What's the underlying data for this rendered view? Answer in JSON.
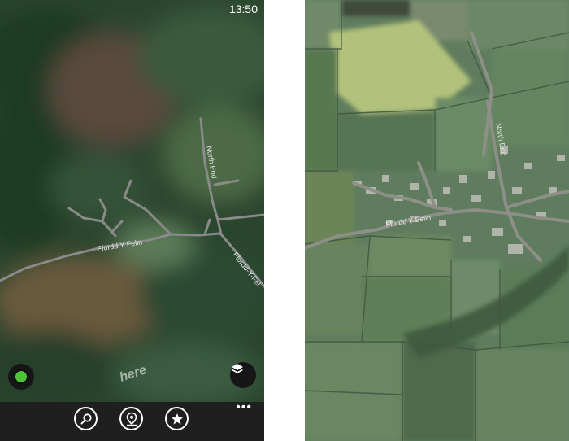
{
  "status_bar": {
    "time": "13:50"
  },
  "phone_map": {
    "roads": [
      "North End",
      "Ffordd Y Felin",
      "Ffordd-Y-Fel"
    ],
    "watermark": "here",
    "location_button_icon": "location-dot-icon",
    "layers_button_icon": "layers-icon"
  },
  "app_bar": {
    "buttons": [
      {
        "icon": "search-icon"
      },
      {
        "icon": "places-icon"
      },
      {
        "icon": "favorites-icon"
      }
    ],
    "more_icon": "ellipsis-icon",
    "more_label": "•••"
  },
  "aerial_map": {
    "roads": [
      "North End",
      "Ffordd Y Felin"
    ]
  },
  "colors": {
    "location_dot": "#4fc23a",
    "road": "#8a8a8a",
    "app_bar": "#1f1f1f"
  }
}
